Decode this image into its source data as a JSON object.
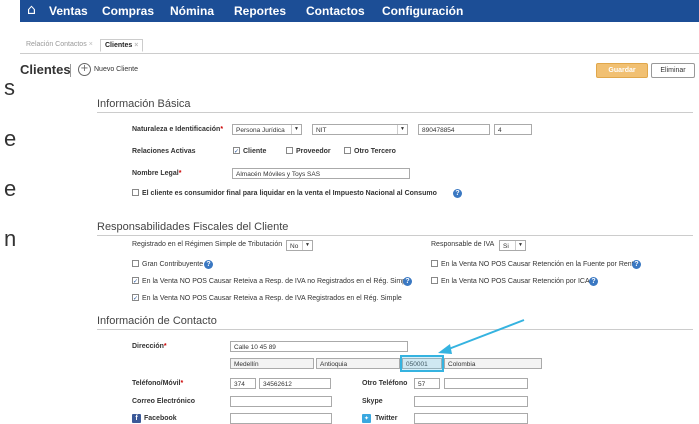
{
  "side_letters": [
    "s",
    "e",
    "e",
    "n"
  ],
  "nav": {
    "home_icon": "home-icon",
    "items": [
      "Ventas",
      "Compras",
      "Nómina",
      "Reportes",
      "Contactos",
      "Configuración"
    ]
  },
  "tabs": [
    {
      "label": "Relación Contactos",
      "close": "×"
    },
    {
      "label": "Clientes",
      "close": "×"
    }
  ],
  "page": {
    "title": "Clientes",
    "new_label": "Nuevo Cliente",
    "save_label": "Guardar",
    "delete_label": "Eliminar"
  },
  "basic": {
    "title": "Información Básica",
    "nature_label": "Naturaleza e Identificación",
    "nature_value": "Persona Jurídica",
    "id_type_value": "NIT",
    "id_number": "890478854",
    "check_digit": "4",
    "relations_label": "Relaciones Activas",
    "relations": [
      {
        "label": "Cliente",
        "checked": true
      },
      {
        "label": "Proveedor",
        "checked": false
      },
      {
        "label": "Otro Tercero",
        "checked": false
      }
    ],
    "legal_name_label": "Nombre Legal",
    "legal_name_value": "Almacén Móviles y Toys SAS",
    "consumer_label": "El cliente es consumidor final para liquidar en la venta el Impuesto Nacional al Consumo",
    "help_glyph": "?"
  },
  "fiscal": {
    "title": "Responsabilidades Fiscales del Cliente",
    "regime_label": "Registrado en el Régimen Simple de Tributación",
    "regime_value": "No",
    "iva_label": "Responsable de IVA",
    "iva_value": "Si",
    "checks": [
      {
        "label": "Gran Contribuyente",
        "checked": false
      },
      {
        "label": "En la Venta NO POS Causar Reteiva a Resp. de IVA no Registrados en el Rég. Simple",
        "checked": true
      },
      {
        "label": "En la Venta NO POS Causar Reteiva a Resp. de IVA Registrados en el Rég. Simple",
        "checked": true
      },
      {
        "label": "En la Venta NO POS Causar Retención en la Fuente por Renta",
        "checked": false
      },
      {
        "label": "En la Venta NO POS Causar Retención por ICA",
        "checked": false
      }
    ]
  },
  "contact": {
    "title": "Información de Contacto",
    "address_label": "Dirección",
    "address_value": "Calle 10 45 89",
    "city": "Medellín",
    "department": "Antioquia",
    "postal_code": "050001",
    "country": "Colombia",
    "phone_label": "Teléfono/Móvil",
    "phone_prefix": "374",
    "phone_number": "34562612",
    "other_phone_label": "Otro Teléfono",
    "other_phone_prefix": "57",
    "other_phone_number": "",
    "email_label": "Correo Electrónico",
    "email_value": "",
    "skype_label": "Skype",
    "skype_value": "",
    "facebook_label": "Facebook",
    "facebook_value": "",
    "twitter_label": "Twitter",
    "twitter_value": ""
  },
  "colors": {
    "nav_bg": "#1c4e96",
    "save_bg": "#f1c072",
    "highlight": "#35b3e0",
    "help": "#3a78c2"
  }
}
